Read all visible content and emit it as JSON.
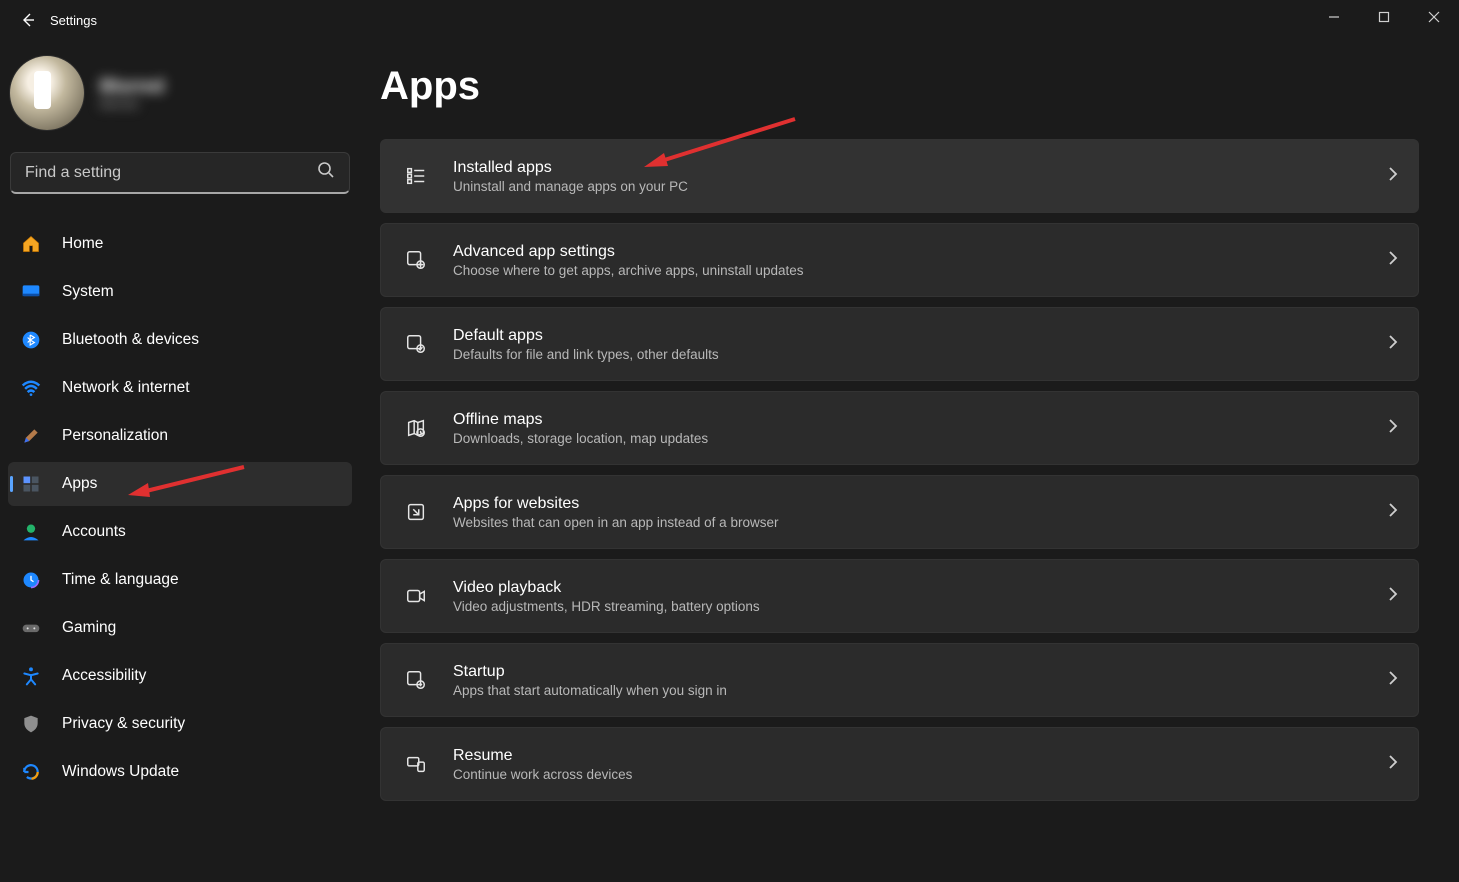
{
  "window": {
    "app_title": "Settings"
  },
  "profile": {
    "name": "Blurred",
    "email": "blurred"
  },
  "search": {
    "placeholder": "Find a setting"
  },
  "sidebar": {
    "items": [
      {
        "label": "Home"
      },
      {
        "label": "System"
      },
      {
        "label": "Bluetooth & devices"
      },
      {
        "label": "Network & internet"
      },
      {
        "label": "Personalization"
      },
      {
        "label": "Apps"
      },
      {
        "label": "Accounts"
      },
      {
        "label": "Time & language"
      },
      {
        "label": "Gaming"
      },
      {
        "label": "Accessibility"
      },
      {
        "label": "Privacy & security"
      },
      {
        "label": "Windows Update"
      }
    ],
    "selected_index": 5
  },
  "page": {
    "title": "Apps"
  },
  "cards": [
    {
      "title": "Installed apps",
      "sub": "Uninstall and manage apps on your PC"
    },
    {
      "title": "Advanced app settings",
      "sub": "Choose where to get apps, archive apps, uninstall updates"
    },
    {
      "title": "Default apps",
      "sub": "Defaults for file and link types, other defaults"
    },
    {
      "title": "Offline maps",
      "sub": "Downloads, storage location, map updates"
    },
    {
      "title": "Apps for websites",
      "sub": "Websites that can open in an app instead of a browser"
    },
    {
      "title": "Video playback",
      "sub": "Video adjustments, HDR streaming, battery options"
    },
    {
      "title": "Startup",
      "sub": "Apps that start automatically when you sign in"
    },
    {
      "title": "Resume",
      "sub": "Continue work across devices"
    }
  ]
}
